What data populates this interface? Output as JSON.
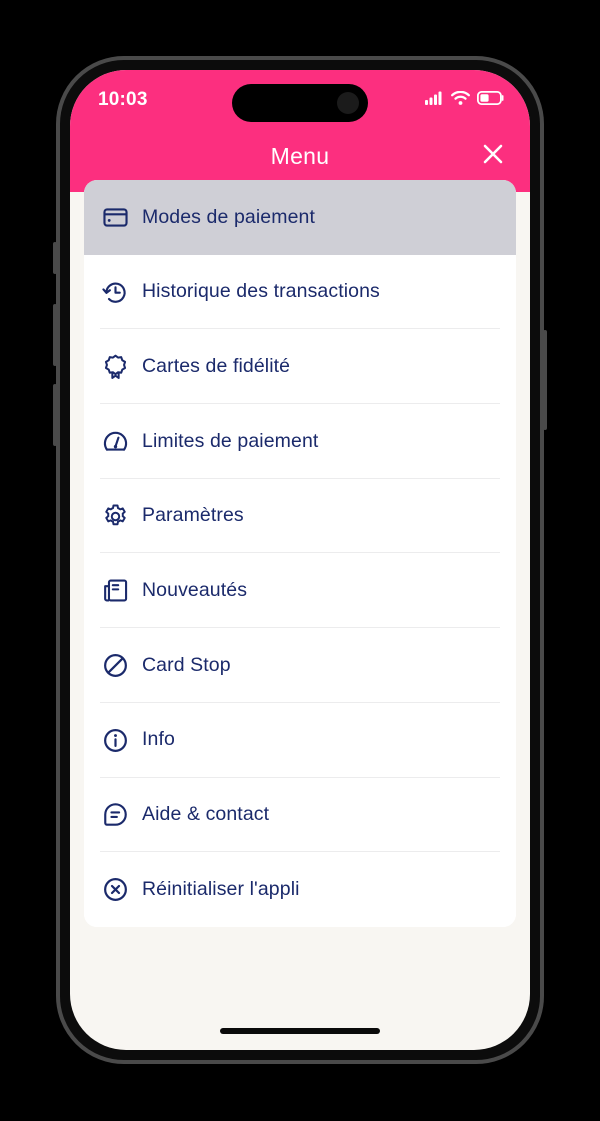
{
  "colors": {
    "brand_pink": "#FC2F7F",
    "navy": "#1B2A6B",
    "selected_row_gray": "#CFCFD6",
    "card_white": "#FFFFFF",
    "screen_background": "#F8F6F2",
    "divider": "#ECECED"
  },
  "status_bar": {
    "time": "10:03",
    "signal_icon": "cellular-signal-icon",
    "signal_bars_filled": 4,
    "signal_bars_total": 4,
    "wifi_icon": "wifi-icon",
    "battery_icon": "battery-icon",
    "battery_level_percent": 40
  },
  "header": {
    "title": "Menu",
    "close_icon": "close-icon"
  },
  "menu": {
    "items": [
      {
        "label": "Modes de paiement",
        "icon": "credit-card-icon",
        "selected": true
      },
      {
        "label": "Historique des transactions",
        "icon": "clock-history-icon",
        "selected": false
      },
      {
        "label": "Cartes de fidélité",
        "icon": "loyalty-badge-icon",
        "selected": false
      },
      {
        "label": "Limites de paiement",
        "icon": "speedometer-icon",
        "selected": false
      },
      {
        "label": "Paramètres",
        "icon": "gear-icon",
        "selected": false
      },
      {
        "label": "Nouveautés",
        "icon": "newspaper-icon",
        "selected": false
      },
      {
        "label": "Card Stop",
        "icon": "prohibition-icon",
        "selected": false
      },
      {
        "label": "Info",
        "icon": "info-circle-icon",
        "selected": false
      },
      {
        "label": "Aide & contact",
        "icon": "chat-bubble-icon",
        "selected": false
      },
      {
        "label": "Réinitialiser l'appli",
        "icon": "x-circle-icon",
        "selected": false
      }
    ]
  },
  "home_indicator": "home-indicator"
}
